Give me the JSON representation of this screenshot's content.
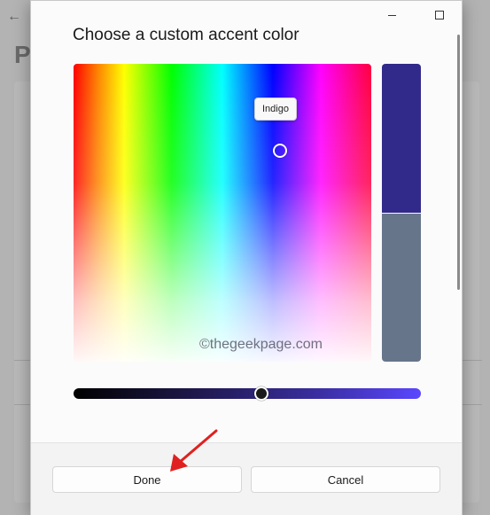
{
  "background": {
    "back_icon": "arrow-left-icon",
    "title_partial": "P"
  },
  "dialog": {
    "title": "Choose a custom accent color",
    "window_controls": {
      "minimize_icon": "minimize-icon",
      "maximize_icon": "maximize-icon"
    },
    "color_picker": {
      "tooltip": "Indigo",
      "new_color": "#312a8a",
      "previous_color": "#66758a",
      "brightness_level": 0.54
    },
    "watermark": "©thegeekpage.com",
    "buttons": {
      "done": "Done",
      "cancel": "Cancel"
    }
  },
  "annotation": {
    "arrow_color": "#e02020",
    "arrow_icon": "red-arrow-icon"
  }
}
